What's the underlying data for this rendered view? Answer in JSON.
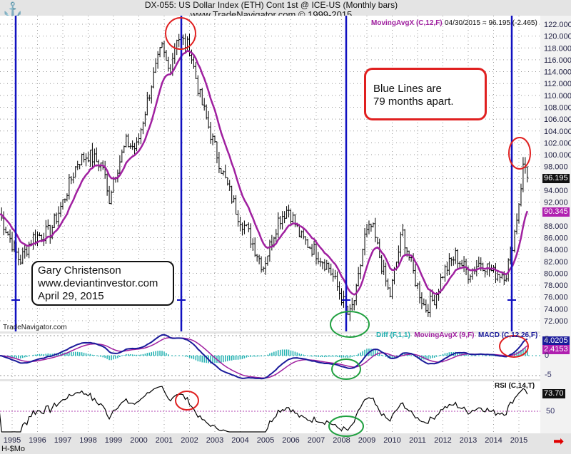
{
  "header": {
    "title": "DX-055:  US Dollar Index (ETH) Cont 1st @ ICE-US  (Monthly bars)",
    "subtitle": "www.TradeNavigator.com © 1999-2015",
    "logo": "sextant-logo"
  },
  "price_panel": {
    "legend_ma": "MovingAvgX (C,12,F)",
    "legend_value": "04/30/2015 = 96.195 (-2.465)",
    "last_price_label": "96.195",
    "ma_label": "90.345",
    "watermark": "TradeNavigator.com"
  },
  "macd_panel": {
    "legend_diff": "Diff (F,1,1)",
    "legend_signal": "MovingAvgX (9,F)",
    "legend_macd": "MACD (C,12,26,F)",
    "macd_label": "4.0205",
    "signal_label": "2.4153",
    "ticks": [
      "5",
      "0",
      "-5"
    ]
  },
  "rsi_panel": {
    "legend": "RSI (C,14,T)",
    "rsi_label": "73.70",
    "ticks": [
      "50"
    ]
  },
  "annotations": {
    "blue_lines_1": "Blue Lines are",
    "blue_lines_2": "79 months apart.",
    "author": "Gary Christenson",
    "site": "www.deviantinvestor.com",
    "date": "April 29, 2015"
  },
  "footer": {
    "symbol": "H-$Mo",
    "scroll_icon": "red-arrow-right-icon"
  },
  "colors": {
    "price_bars": "#000000",
    "moving_avg": "#a020a0",
    "macd": "#1a1a9a",
    "diff": "#20b0b0",
    "blue_lines": "#1010c0",
    "circle_red": "#e02020",
    "circle_green": "#20a040"
  },
  "chart_data": {
    "type": "ohlc-bar",
    "title": "DX-055:  US Dollar Index (ETH) Cont 1st @ ICE-US  (Monthly bars)",
    "x_ticks": [
      "1995",
      "1996",
      "1997",
      "1998",
      "1999",
      "2000",
      "2001",
      "2002",
      "2003",
      "2004",
      "2005",
      "2006",
      "2007",
      "2008",
      "2009",
      "2010",
      "2011",
      "2012",
      "2013",
      "2014",
      "2015"
    ],
    "y_ticks": [
      "122.000",
      "120.000",
      "118.000",
      "116.000",
      "114.000",
      "112.000",
      "110.000",
      "108.000",
      "106.000",
      "104.000",
      "102.000",
      "100.000",
      "98.000",
      "96.000",
      "94.000",
      "92.000",
      "90.000",
      "88.000",
      "86.000",
      "84.000",
      "82.000",
      "80.000",
      "78.000",
      "76.000",
      "74.000",
      "72.000"
    ],
    "ylim": [
      71,
      123
    ],
    "close_path": {
      "x": [
        1994.5,
        1995.3,
        1995.8,
        1996.5,
        1997.0,
        1997.6,
        1998.0,
        1998.6,
        1998.8,
        1999.0,
        1999.5,
        1999.9,
        2000.5,
        2000.9,
        2001.2,
        2001.5,
        2002.0,
        2002.4,
        2002.8,
        2003.3,
        2003.9,
        2004.3,
        2004.9,
        2005.5,
        2005.9,
        2006.4,
        2006.9,
        2007.5,
        2008.0,
        2008.3,
        2008.6,
        2008.9,
        2009.2,
        2009.9,
        2010.4,
        2010.9,
        2011.3,
        2011.7,
        2012.0,
        2012.5,
        2013.0,
        2013.5,
        2014.0,
        2014.5,
        2014.8,
        2015.0,
        2015.2,
        2015.33
      ],
      "y": [
        90,
        82,
        86,
        87,
        92,
        99,
        100,
        98,
        92,
        96,
        102,
        101,
        112,
        118,
        114,
        120,
        118,
        110,
        104,
        97,
        90,
        87,
        81,
        89,
        91,
        86,
        84,
        81,
        76,
        72.5,
        77,
        86,
        88,
        76,
        87,
        79,
        74,
        76,
        80,
        83,
        80,
        82,
        80,
        80,
        86,
        92,
        99,
        96.195
      ]
    },
    "last_close": 96.195,
    "change": -2.465,
    "ma_last": 90.345,
    "macd_last": 4.0205,
    "signal_last": 2.4153,
    "rsi_last": 73.7,
    "rsi_ref_line": 50,
    "blue_lines": [
      "1995-01",
      "2001-08",
      "2008-03",
      "2014-10"
    ],
    "red_circles": [
      "2001 high",
      "2015 high",
      "MACD 2015",
      "RSI 2001"
    ],
    "green_circles": [
      "2008 low",
      "MACD 2008",
      "RSI 2008"
    ]
  }
}
